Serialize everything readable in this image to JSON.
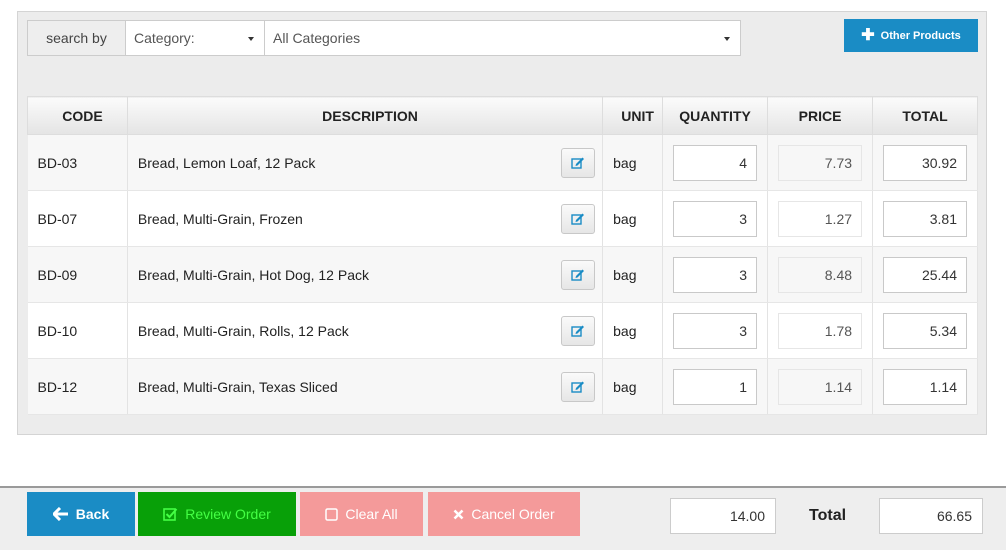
{
  "search": {
    "label": "search by",
    "field_value": "Category:",
    "category_value": "All Categories"
  },
  "other_products": {
    "label": "Other Products",
    "icon": "plus-icon"
  },
  "table": {
    "headers": {
      "code": "CODE",
      "description": "DESCRIPTION",
      "unit": "UNIT",
      "quantity": "QUANTITY",
      "price": "PRICE",
      "total": "TOTAL"
    },
    "rows": [
      {
        "code": "BD-03",
        "description": "Bread, Lemon Loaf, 12 Pack",
        "unit": "bag",
        "quantity": "4",
        "price": "7.73",
        "total": "30.92"
      },
      {
        "code": "BD-07",
        "description": "Bread, Multi-Grain, Frozen",
        "unit": "bag",
        "quantity": "3",
        "price": "1.27",
        "total": "3.81"
      },
      {
        "code": "BD-09",
        "description": "Bread, Multi-Grain, Hot Dog, 12 Pack",
        "unit": "bag",
        "quantity": "3",
        "price": "8.48",
        "total": "25.44"
      },
      {
        "code": "BD-10",
        "description": "Bread, Multi-Grain, Rolls, 12 Pack",
        "unit": "bag",
        "quantity": "3",
        "price": "1.78",
        "total": "5.34"
      },
      {
        "code": "BD-12",
        "description": "Bread, Multi-Grain, Texas Sliced",
        "unit": "bag",
        "quantity": "1",
        "price": "1.14",
        "total": "1.14"
      }
    ]
  },
  "footer": {
    "back_label": "Back",
    "review_label": "Review Order",
    "clear_label": "Clear All",
    "cancel_label": "Cancel Order",
    "quantity_sum": "14.00",
    "total_label": "Total",
    "total_value": "66.65"
  },
  "colors": {
    "primary": "#1a8cc5",
    "success": "#08a008",
    "danger_light": "#f49a9a"
  }
}
